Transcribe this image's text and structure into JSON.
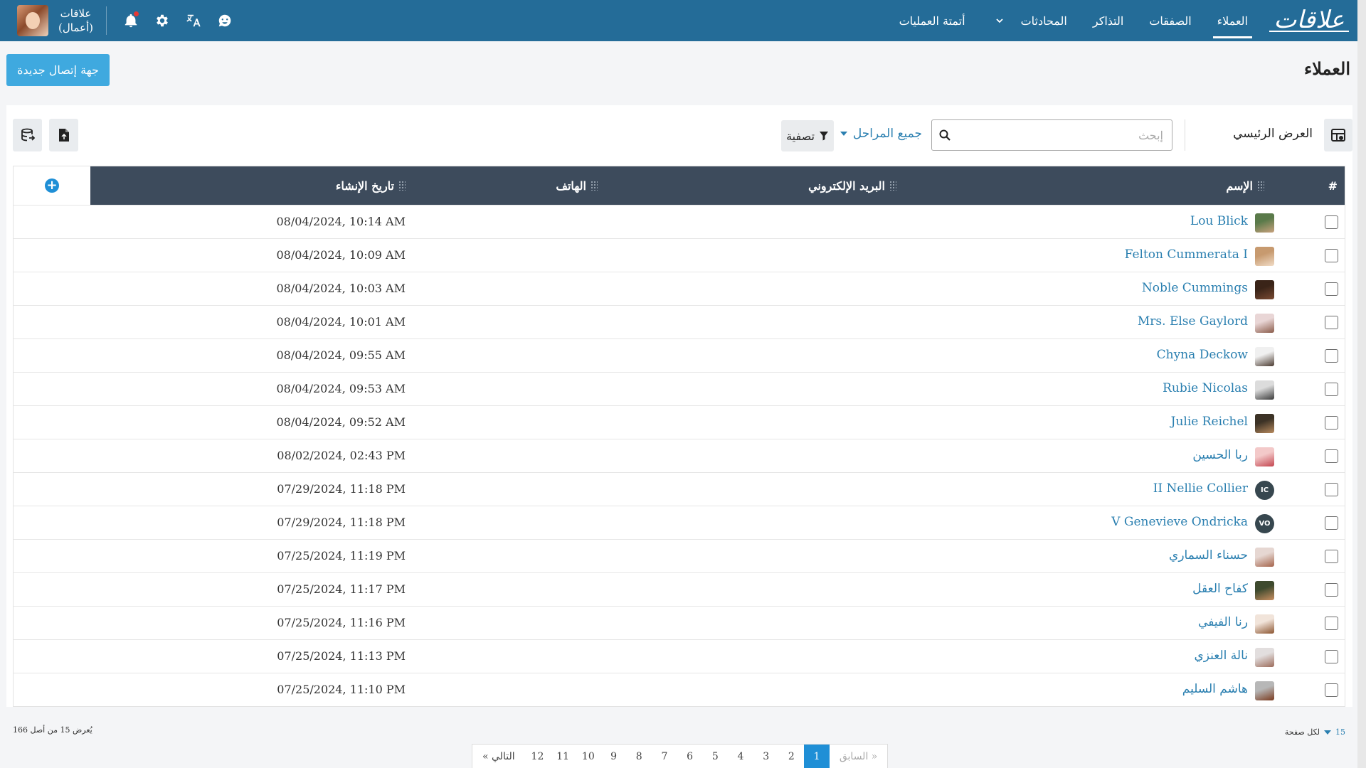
{
  "app": {
    "logo": "علاقات",
    "account_name": "علاقات",
    "account_type": "(أعمال)"
  },
  "nav": {
    "items": [
      {
        "label": "العملاء",
        "active": true
      },
      {
        "label": "الصفقات",
        "active": false
      },
      {
        "label": "التذاكر",
        "active": false
      },
      {
        "label": "المحادثات",
        "active": false
      },
      {
        "label": "أتمتة العمليات",
        "active": false
      }
    ]
  },
  "page": {
    "title": "العملاء",
    "new_contact_label": "جهة إتصال جديدة"
  },
  "toolbar": {
    "view_label": "العرض الرئيسي",
    "search_placeholder": "إبحث",
    "stages_label": "جميع المراحل",
    "filter_label": "تصفية"
  },
  "table": {
    "columns": {
      "index": "#",
      "name": "الإسم",
      "email": "البريد الإلكتروني",
      "phone": "الهاتف",
      "created": "تاريخ الإنشاء"
    },
    "rows": [
      {
        "name": "Lou Blick",
        "date": "08/04/2024, 10:14 AM",
        "avatar": "photo",
        "colors": [
          "#5a7a4a",
          "#c9a27e"
        ]
      },
      {
        "name": "Felton Cummerata I",
        "date": "08/04/2024, 10:09 AM",
        "avatar": "photo",
        "colors": [
          "#c79a6f",
          "#f1dcc6"
        ]
      },
      {
        "name": "Noble Cummings",
        "date": "08/04/2024, 10:03 AM",
        "avatar": "photo",
        "colors": [
          "#3a2418",
          "#7a4a32"
        ]
      },
      {
        "name": "Mrs. Else Gaylord",
        "date": "08/04/2024, 10:01 AM",
        "avatar": "photo",
        "colors": [
          "#e9d6d6",
          "#8a5b4a"
        ]
      },
      {
        "name": "Chyna Deckow",
        "date": "08/04/2024, 09:55 AM",
        "avatar": "photo",
        "colors": [
          "#f0f0f0",
          "#4a3a30"
        ]
      },
      {
        "name": "Rubie Nicolas",
        "date": "08/04/2024, 09:53 AM",
        "avatar": "photo",
        "colors": [
          "#dcdcdc",
          "#3a3a3a"
        ]
      },
      {
        "name": "Julie Reichel",
        "date": "08/04/2024, 09:52 AM",
        "avatar": "photo",
        "colors": [
          "#3c3226",
          "#b88a5e"
        ]
      },
      {
        "name": "ربا الحسين",
        "date": "08/02/2024, 02:43 PM",
        "avatar": "photo",
        "colors": [
          "#f3c9c9",
          "#c4454f"
        ]
      },
      {
        "name": "II Nellie Collier",
        "date": "07/29/2024, 11:18 PM",
        "avatar": "IC",
        "colors": []
      },
      {
        "name": "V Genevieve Ondricka",
        "date": "07/29/2024, 11:18 PM",
        "avatar": "VO",
        "colors": []
      },
      {
        "name": "حسناء السماري",
        "date": "07/25/2024, 11:19 PM",
        "avatar": "photo",
        "colors": [
          "#e6d7d2",
          "#a5634a"
        ]
      },
      {
        "name": "كفاح العقل",
        "date": "07/25/2024, 11:17 PM",
        "avatar": "photo",
        "colors": [
          "#3e4a2e",
          "#c98f61"
        ]
      },
      {
        "name": "رنا الفيفي",
        "date": "07/25/2024, 11:16 PM",
        "avatar": "photo",
        "colors": [
          "#f1e4da",
          "#8c5530"
        ]
      },
      {
        "name": "نالة العنزي",
        "date": "07/25/2024, 11:13 PM",
        "avatar": "photo",
        "colors": [
          "#e2dede",
          "#9c6b5a"
        ]
      },
      {
        "name": "هاشم السليم",
        "date": "07/25/2024, 11:10 PM",
        "avatar": "photo",
        "colors": [
          "#b7b7b7",
          "#7a3a1e"
        ]
      }
    ]
  },
  "footer": {
    "per_page_value": "15",
    "per_page_label": "لكل صفحة",
    "showing_text": "يُعرض 15 من أصل 166",
    "pager": {
      "prev": "« السابق",
      "next": "التالي »",
      "pages": [
        "1",
        "2",
        "3",
        "4",
        "5",
        "6",
        "7",
        "8",
        "9",
        "10",
        "11",
        "12"
      ],
      "current": "1"
    }
  },
  "colors": {
    "topbar": "#246c98",
    "accent": "#1f8fd6",
    "header": "#3d4b5c",
    "link": "#2a7fb0"
  }
}
